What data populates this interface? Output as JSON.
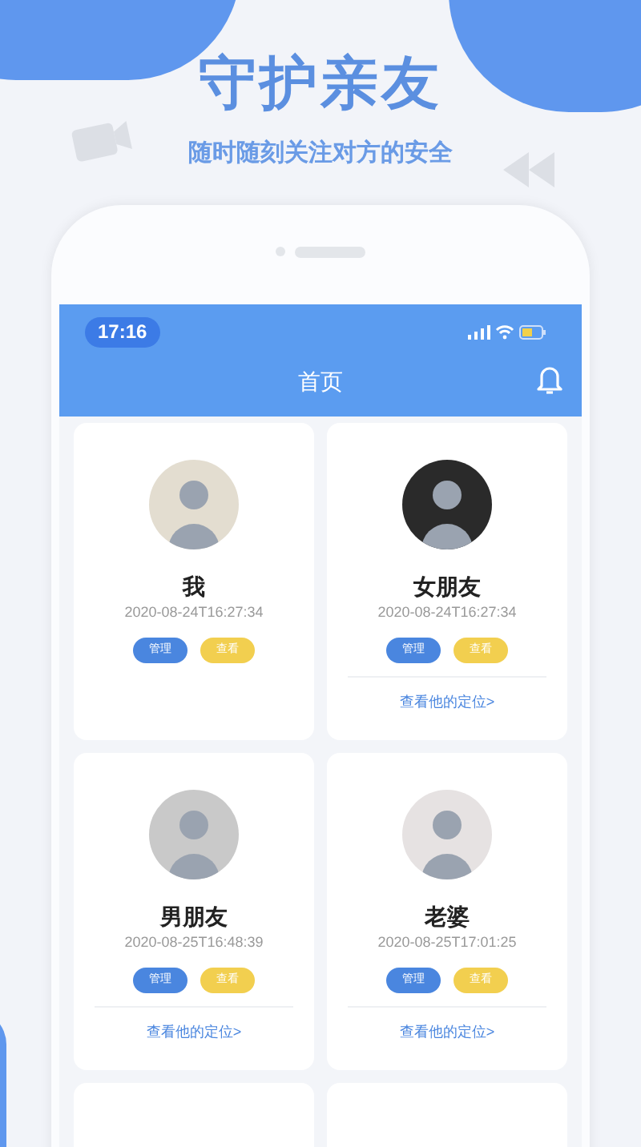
{
  "headline": "守护亲友",
  "subtitle": "随时随刻关注对方的安全",
  "status_bar": {
    "time": "17:16"
  },
  "header": {
    "title": "首页"
  },
  "contacts": [
    {
      "name": "我",
      "time": "2020-08-24T16:27:34",
      "buttons": [
        "管理",
        "查看"
      ]
    },
    {
      "name": "女朋友",
      "time": "2020-08-24T16:27:34",
      "buttons": [
        "管理",
        "查看"
      ],
      "location_link": "查看他的定位>"
    },
    {
      "name": "男朋友",
      "time": "2020-08-25T16:48:39",
      "buttons": [
        "管理",
        "查看"
      ],
      "location_link": "查看他的定位>"
    },
    {
      "name": "老婆",
      "time": "2020-08-25T17:01:25",
      "buttons": [
        "管理",
        "查看"
      ],
      "location_link": "查看他的定位>"
    }
  ]
}
